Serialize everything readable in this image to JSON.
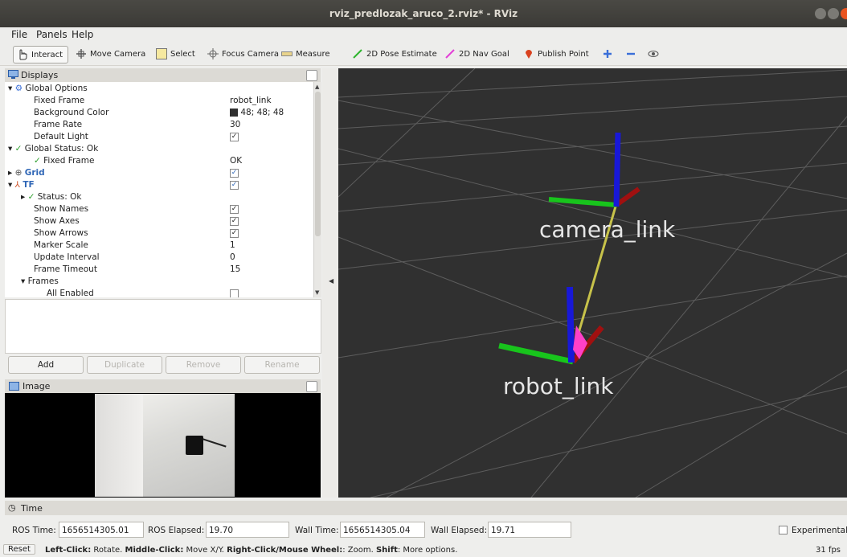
{
  "window": {
    "title": "rviz_predlozak_aruco_2.rviz* - RViz"
  },
  "menu": [
    "File",
    "Panels",
    "Help"
  ],
  "toolbar": {
    "interact": "Interact",
    "move_camera": "Move Camera",
    "select": "Select",
    "focus_camera": "Focus Camera",
    "measure": "Measure",
    "pose_estimate": "2D Pose Estimate",
    "nav_goal": "2D Nav Goal",
    "publish_point": "Publish Point"
  },
  "displays": {
    "title": "Displays",
    "rows": {
      "global_options": "Global Options",
      "fixed_frame": "Fixed Frame",
      "fixed_frame_val": "robot_link",
      "background_color": "Background Color",
      "background_color_val": "48; 48; 48",
      "frame_rate": "Frame Rate",
      "frame_rate_val": "30",
      "default_light": "Default Light",
      "global_status": "Global Status: Ok",
      "fixed_frame_status": "Fixed Frame",
      "fixed_frame_status_val": "OK",
      "grid": "Grid",
      "tf": "TF",
      "status_ok": "Status: Ok",
      "show_names": "Show Names",
      "show_axes": "Show Axes",
      "show_arrows": "Show Arrows",
      "marker_scale": "Marker Scale",
      "marker_scale_val": "1",
      "update_interval": "Update Interval",
      "update_interval_val": "0",
      "frame_timeout": "Frame Timeout",
      "frame_timeout_val": "15",
      "frames": "Frames",
      "all_enabled": "All Enabled"
    },
    "buttons": {
      "add": "Add",
      "duplicate": "Duplicate",
      "remove": "Remove",
      "rename": "Rename"
    }
  },
  "image_panel": {
    "title": "Image"
  },
  "view3d": {
    "labels": {
      "camera": "camera_link",
      "robot": "robot_link"
    }
  },
  "time": {
    "title": "Time",
    "ros_time_label": "ROS Time:",
    "ros_time": "1656514305.01",
    "ros_elapsed_label": "ROS Elapsed:",
    "ros_elapsed": "19.70",
    "wall_time_label": "Wall Time:",
    "wall_time": "1656514305.04",
    "wall_elapsed_label": "Wall Elapsed:",
    "wall_elapsed": "19.71",
    "experimental": "Experimental"
  },
  "status": {
    "reset": "Reset",
    "k1": "Left-Click:",
    "t1": " Rotate. ",
    "k2": "Middle-Click:",
    "t2": " Move X/Y. ",
    "k3": "Right-Click/Mouse Wheel:",
    "t3": ": Zoom. ",
    "k4": "Shift",
    "t4": ": More options.",
    "fps": "31 fps"
  },
  "colors": {
    "background": "#303030",
    "accent": "#e95420",
    "selected_text": "#2f66b6"
  }
}
